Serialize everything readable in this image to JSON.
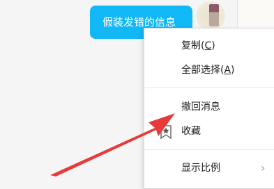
{
  "message": {
    "text": "假装发错的信息",
    "bubble_color": "#12b7f5"
  },
  "context_menu": {
    "copy": {
      "label": "复制(",
      "key": "C",
      "end": ")"
    },
    "select_all": {
      "label": "全部选择(",
      "key": "A",
      "end": ")"
    },
    "recall": {
      "label": "撤回消息"
    },
    "favorite": {
      "label": "收藏",
      "icon": "bookmark-star-icon"
    },
    "display_ratio": {
      "label": "显示比例",
      "icon": "chevron-right-icon",
      "chevron": "›"
    }
  },
  "annotation": {
    "arrow_color": "#e83a3a"
  }
}
